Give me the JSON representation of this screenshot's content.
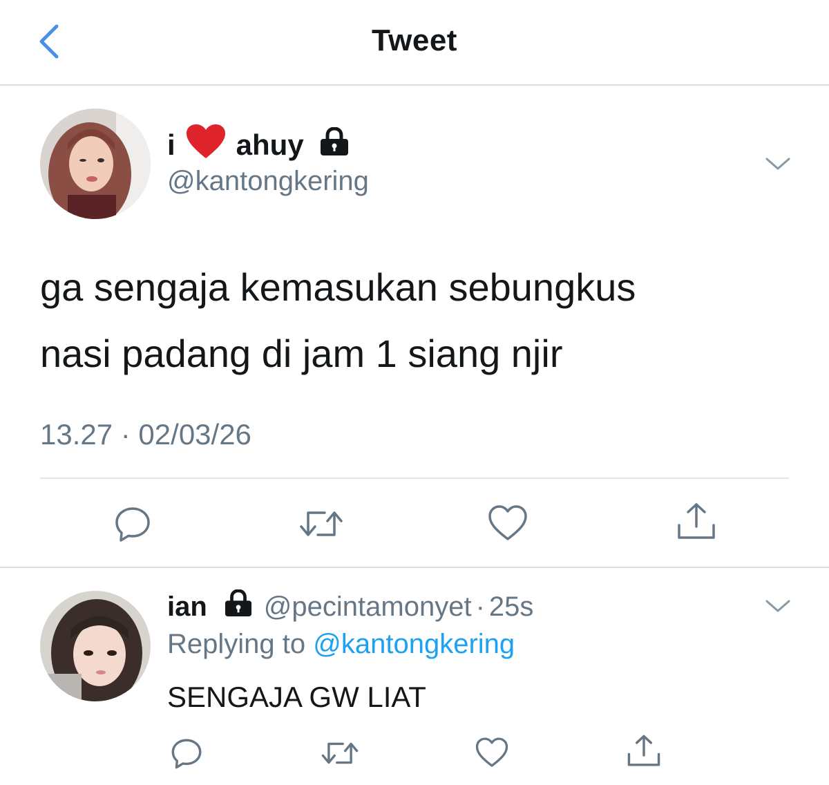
{
  "header": {
    "title": "Tweet",
    "back_icon": "chevron-left-icon"
  },
  "colors": {
    "accent": "#1da1f2",
    "secondary_text": "#657786",
    "primary_text": "#14171a",
    "divider": "#e1e8ed",
    "heart_emoji": "#e0242c"
  },
  "tweet": {
    "name_prefix": "i",
    "name_emoji": "heart-emoji-icon",
    "name_suffix": "ahuy",
    "protected_icon": "lock-icon",
    "handle": "@kantongkering",
    "text_lines": [
      "ga sengaja kemasukan sebungkus",
      "nasi padang di jam 1 siang njir"
    ],
    "timestamp": "13.27 · 02/03/26",
    "actions": [
      "reply-icon",
      "retweet-icon",
      "like-icon",
      "share-icon"
    ]
  },
  "reply": {
    "name": "ian",
    "protected_icon": "lock-icon",
    "handle": "@pecintamonyet",
    "separator": "·",
    "time": "25s",
    "replying_prefix": "Replying to",
    "replying_to": "@kantongkering",
    "text": "SENGAJA GW LIAT",
    "actions": [
      "reply-icon",
      "retweet-icon",
      "like-icon",
      "share-icon"
    ]
  }
}
